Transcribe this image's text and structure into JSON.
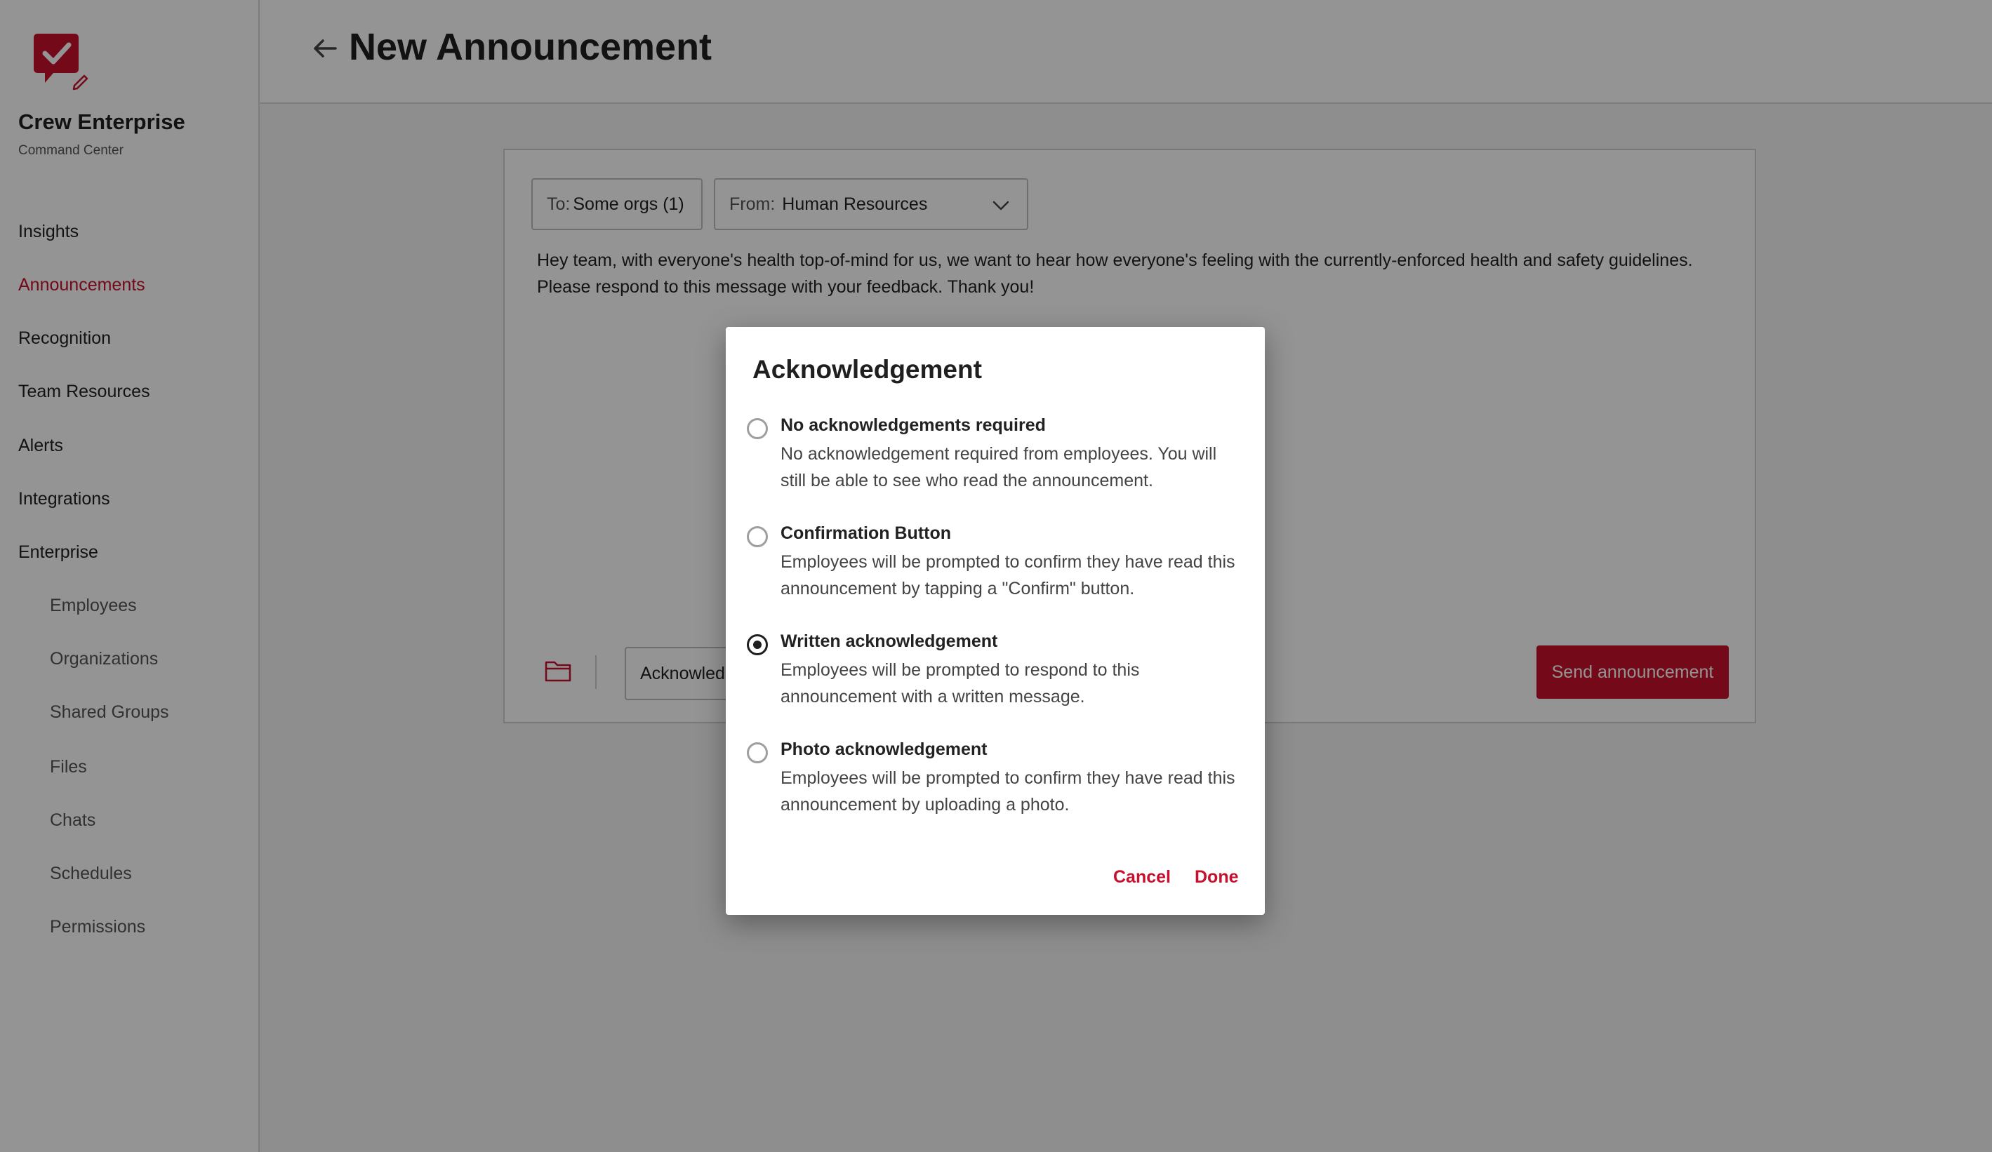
{
  "app": {
    "name": "Crew Enterprise",
    "subtitle": "Command Center",
    "brand_color": "#c8102e"
  },
  "sidebar": {
    "items": [
      {
        "label": "Insights",
        "active": false
      },
      {
        "label": "Announcements",
        "active": true
      },
      {
        "label": "Recognition",
        "active": false
      },
      {
        "label": "Team Resources",
        "active": false
      },
      {
        "label": "Alerts",
        "active": false
      },
      {
        "label": "Integrations",
        "active": false
      },
      {
        "label": "Enterprise",
        "active": false
      }
    ],
    "subitems": [
      {
        "label": "Employees"
      },
      {
        "label": "Organizations"
      },
      {
        "label": "Shared Groups"
      },
      {
        "label": "Files"
      },
      {
        "label": "Chats"
      },
      {
        "label": "Schedules"
      },
      {
        "label": "Permissions"
      }
    ]
  },
  "header": {
    "title": "New Announcement",
    "back_icon": "arrow-left-icon"
  },
  "composer": {
    "to_label": "To:",
    "to_value": "Some orgs (1)",
    "from_label": "From:",
    "from_value": "Human Resources",
    "message_line1": "Hey team, with everyone's health top-of-mind for us, we want to hear how everyone's feeling with the currently-enforced health and safety guidelines.",
    "message_line2": "Please respond to this message with your feedback. Thank you!",
    "ack_field_value": "Acknowledgement",
    "send_label": "Send announcement",
    "attach_icon": "folder-icon"
  },
  "dialog": {
    "title": "Acknowledgement",
    "options": [
      {
        "title": "No acknowledgements required",
        "description": "No acknowledgement required from employees. You will still be able to see who read the announcement.",
        "selected": false
      },
      {
        "title": "Confirmation Button",
        "description": "Employees will be prompted to confirm they have read this announcement by tapping a \"Confirm\" button.",
        "selected": false
      },
      {
        "title": "Written acknowledgement",
        "description": "Employees will be prompted to respond to this announcement with a written message.",
        "selected": true
      },
      {
        "title": "Photo acknowledgement",
        "description": "Employees will be prompted to confirm they have read this announcement by uploading a photo.",
        "selected": false
      }
    ],
    "cancel_label": "Cancel",
    "done_label": "Done"
  }
}
